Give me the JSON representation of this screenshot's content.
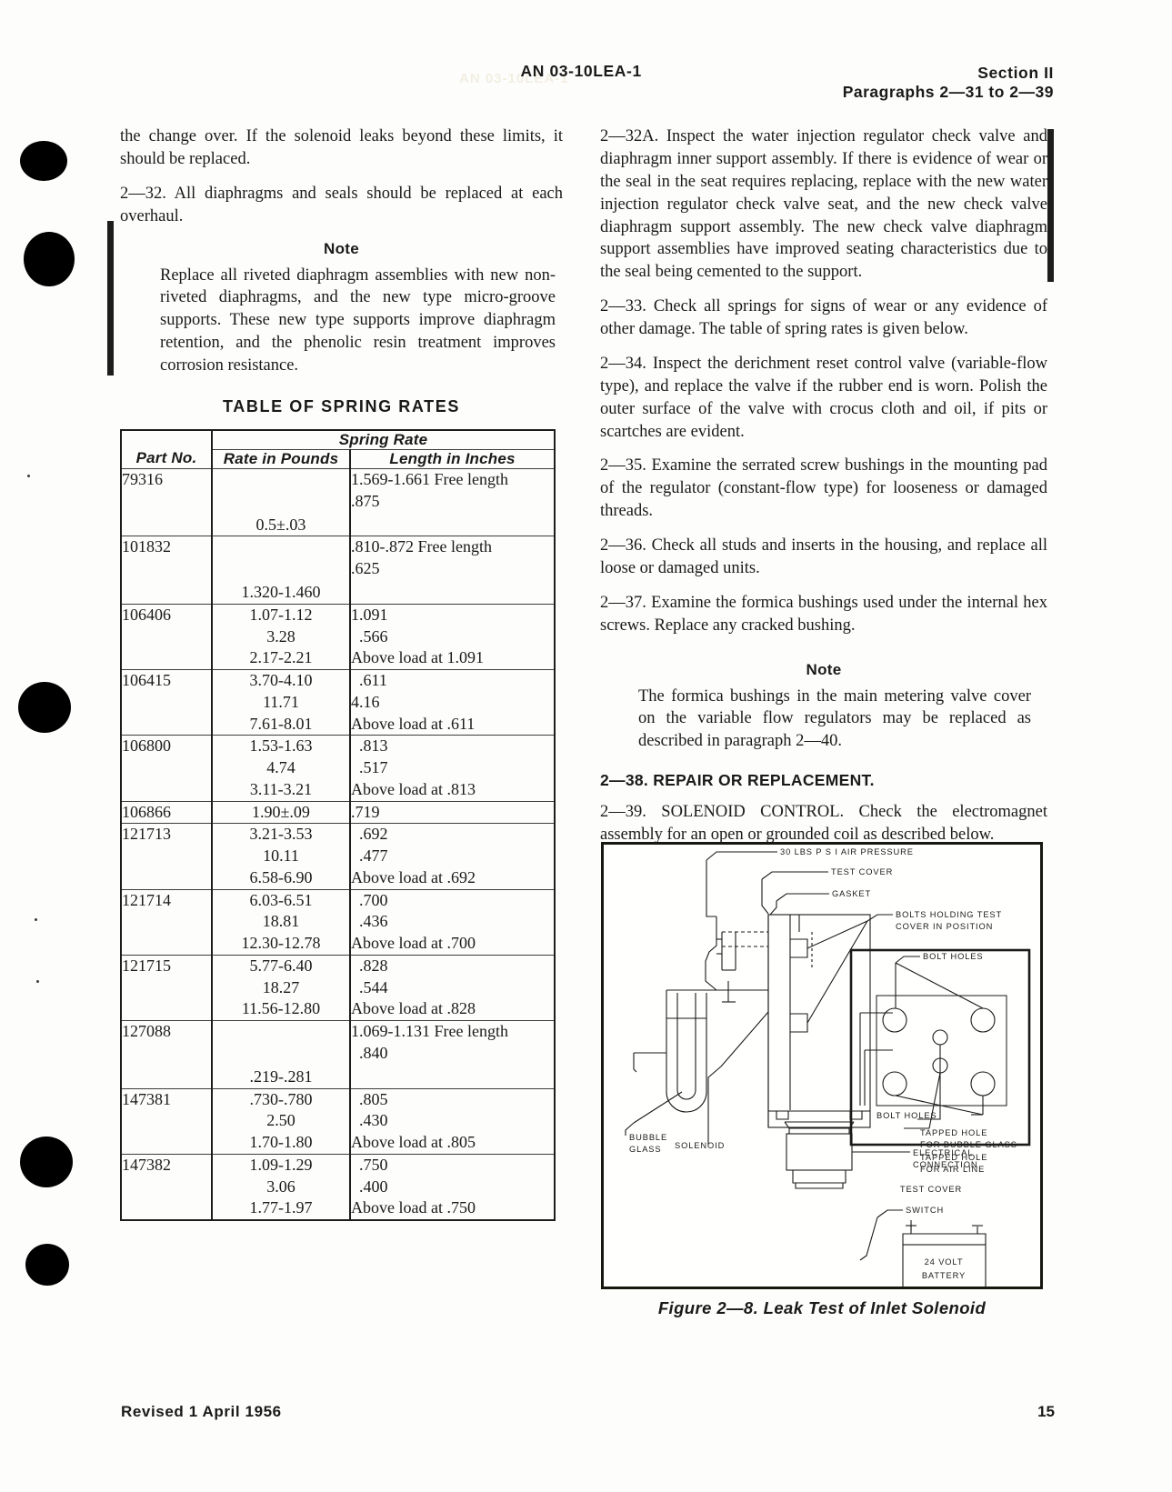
{
  "header": {
    "doc_id": "AN 03-10LEA-1",
    "section": "Section II",
    "paragraphs_range": "Paragraphs 2—31 to 2—39",
    "ghost_text": "AN 03-10LEA-1"
  },
  "left_column": {
    "para_continued": "the change over. If the solenoid leaks beyond these limits, it should be replaced.",
    "para_2_32": "2—32. All diaphragms and seals should be replaced at each overhaul.",
    "note_label": "Note",
    "note_text": "Replace all riveted diaphragm assemblies with new non-riveted diaphragms, and the new type micro-groove supports. These new type supports improve diaphragm retention, and the phenolic resin treatment improves corrosion resistance."
  },
  "table": {
    "title": "TABLE OF SPRING RATES",
    "header_span": "Spring Rate",
    "columns": [
      "Part No.",
      "Rate in Pounds",
      "Length in Inches"
    ],
    "rows": [
      {
        "part_no": "79316",
        "rate": [
          "",
          "0.5±.03"
        ],
        "length": [
          "1.569-1.661 Free length",
          ".875"
        ],
        "rate_offset": true
      },
      {
        "part_no": "101832",
        "rate": [
          "",
          "1.320-1.460"
        ],
        "length": [
          ".810-.872 Free length",
          ".625"
        ],
        "rate_offset": true
      },
      {
        "part_no": "106406",
        "rate": [
          "1.07-1.12",
          "3.28",
          "2.17-2.21"
        ],
        "length": [
          "1.091",
          "  .566",
          "Above load at 1.091"
        ],
        "rate_offset": false
      },
      {
        "part_no": "106415",
        "rate": [
          "3.70-4.10",
          "11.71",
          "7.61-8.01"
        ],
        "length": [
          "  .611",
          "4.16",
          "Above load at .611"
        ],
        "rate_offset": false
      },
      {
        "part_no": "106800",
        "rate": [
          "1.53-1.63",
          "4.74",
          "3.11-3.21"
        ],
        "length": [
          "  .813",
          "  .517",
          "Above load at .813"
        ],
        "rate_offset": false
      },
      {
        "part_no": "106866",
        "rate": [
          "1.90±.09"
        ],
        "length": [
          ".719"
        ],
        "rate_offset": false
      },
      {
        "part_no": "121713",
        "rate": [
          "3.21-3.53",
          "10.11",
          "6.58-6.90"
        ],
        "length": [
          "  .692",
          "  .477",
          "Above load at .692"
        ],
        "rate_offset": false
      },
      {
        "part_no": "121714",
        "rate": [
          "6.03-6.51",
          "18.81",
          "12.30-12.78"
        ],
        "length": [
          "  .700",
          "  .436",
          "Above load at .700"
        ],
        "rate_offset": false
      },
      {
        "part_no": "121715",
        "rate": [
          "5.77-6.40",
          "18.27",
          "11.56-12.80"
        ],
        "length": [
          "  .828",
          "  .544",
          "Above load at .828"
        ],
        "rate_offset": false
      },
      {
        "part_no": "127088",
        "rate": [
          "",
          ".219-.281"
        ],
        "length": [
          "1.069-1.131 Free length",
          "  .840"
        ],
        "rate_offset": true
      },
      {
        "part_no": "147381",
        "rate": [
          ".730-.780",
          "2.50",
          "1.70-1.80"
        ],
        "length": [
          "  .805",
          "  .430",
          "Above load at .805"
        ],
        "rate_offset": false
      },
      {
        "part_no": "147382",
        "rate": [
          "1.09-1.29",
          "3.06",
          "1.77-1.97"
        ],
        "length": [
          "  .750",
          "  .400",
          "Above load at .750"
        ],
        "rate_offset": false
      }
    ]
  },
  "right_column": {
    "para_2_32A": "2—32A. Inspect the water injection regulator check valve and diaphragm inner support assembly. If there is evidence of wear or the seal in the seat requires replacing, replace with the new water injection regulator check valve seat, and the new check valve diaphragm support assembly. The new check valve diaphragm support assemblies have improved seating characteristics due to the seal being cemented to the support.",
    "para_2_33": "2—33. Check all springs for signs of wear or any evidence of other damage. The table of spring rates is given below.",
    "para_2_34": "2—34. Inspect the derichment reset control valve (variable-flow type), and replace the valve if the rubber end is worn. Polish the outer surface of the valve with crocus cloth and oil, if pits or scartches are evident.",
    "para_2_35": "2—35. Examine the serrated screw bushings in the mounting pad of the regulator (constant-flow type) for looseness or damaged threads.",
    "para_2_36": "2—36. Check all studs and inserts in the housing, and replace all loose or damaged units.",
    "para_2_37": "2—37. Examine the formica bushings used under the internal hex screws. Replace any cracked bushing.",
    "note_label": "Note",
    "note_text": "The formica bushings in the main metering valve cover on the variable flow regulators may be replaced as described in paragraph 2—40.",
    "head_2_38": "2—38. REPAIR OR REPLACEMENT.",
    "para_2_39": "2—39. SOLENOID CONTROL. Check the electromagnet assembly for an open or grounded coil as described below."
  },
  "figure": {
    "caption": "Figure 2—8. Leak Test of Inlet Solenoid",
    "labels": {
      "air_pressure": "30 LBS  P S I   AIR  PRESSURE",
      "test_cover_top": "TEST  COVER",
      "gasket": "GASKET",
      "bolts_holding_1": "BOLTS HOLDING  TEST",
      "bolts_holding_2": "COVER IN POSITION",
      "bolt_holes_top": "BOLT  HOLES",
      "bolt_holes_bottom": "BOLT HOLES",
      "tapped_bubble_1": "TAPPED HOLE",
      "tapped_bubble_2": "FOR BUBBLE GLASS",
      "tapped_air_1": "TAPPED  HOLE",
      "tapped_air_2": "FOR AIR LINE",
      "test_cover_inset": "TEST  COVER",
      "bubble_glass_1": "BUBBLE",
      "bubble_glass_2": "GLASS",
      "solenoid": "SOLENOID",
      "electrical_1": "ELECTRICAL",
      "electrical_2": "CONNECTION",
      "switch": "SWITCH",
      "battery_1": "24  VOLT",
      "battery_2": "BATTERY"
    }
  },
  "footer": {
    "revision": "Revised 1 April 1956",
    "page_number": "15"
  }
}
